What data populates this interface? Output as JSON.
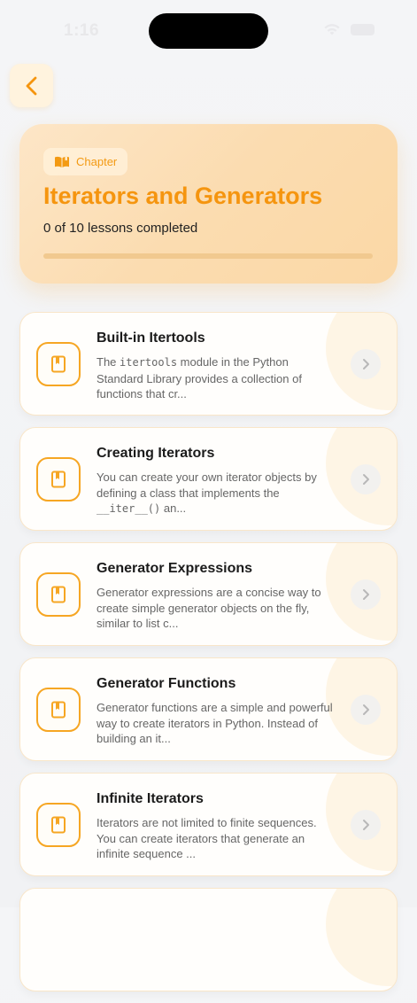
{
  "status": {
    "time": "1:16"
  },
  "chapter": {
    "badge_label": "Chapter",
    "title": "Iterators and Generators",
    "progress_text": "0 of 10 lessons completed",
    "progress_fraction": 0.0
  },
  "lessons": [
    {
      "title": "Built-in Itertools",
      "desc_before": "The ",
      "desc_code": "itertools",
      "desc_after": " module in the Python Standard Library provides a collection of functions that cr..."
    },
    {
      "title": "Creating Iterators",
      "desc_before": "You can create your own iterator objects by defining a class that implements the ",
      "desc_code": "__iter__()",
      "desc_after": " an..."
    },
    {
      "title": "Generator Expressions",
      "desc_before": "Generator expressions are a concise way to create simple generator objects on the fly, similar to list c...",
      "desc_code": "",
      "desc_after": ""
    },
    {
      "title": "Generator Functions",
      "desc_before": "Generator functions are a simple and powerful way to create iterators in Python. Instead of building an it...",
      "desc_code": "",
      "desc_after": ""
    },
    {
      "title": "Infinite Iterators",
      "desc_before": "Iterators are not limited to finite sequences. You can create iterators that generate an infinite sequence ...",
      "desc_code": "",
      "desc_after": ""
    }
  ],
  "colors": {
    "accent": "#f5950f",
    "accent_light": "#fbdcb0"
  },
  "icons": {
    "back": "chevron-left-icon",
    "badge": "book-open-icon",
    "lesson": "bookmark-book-icon",
    "row": "chevron-right-icon"
  }
}
